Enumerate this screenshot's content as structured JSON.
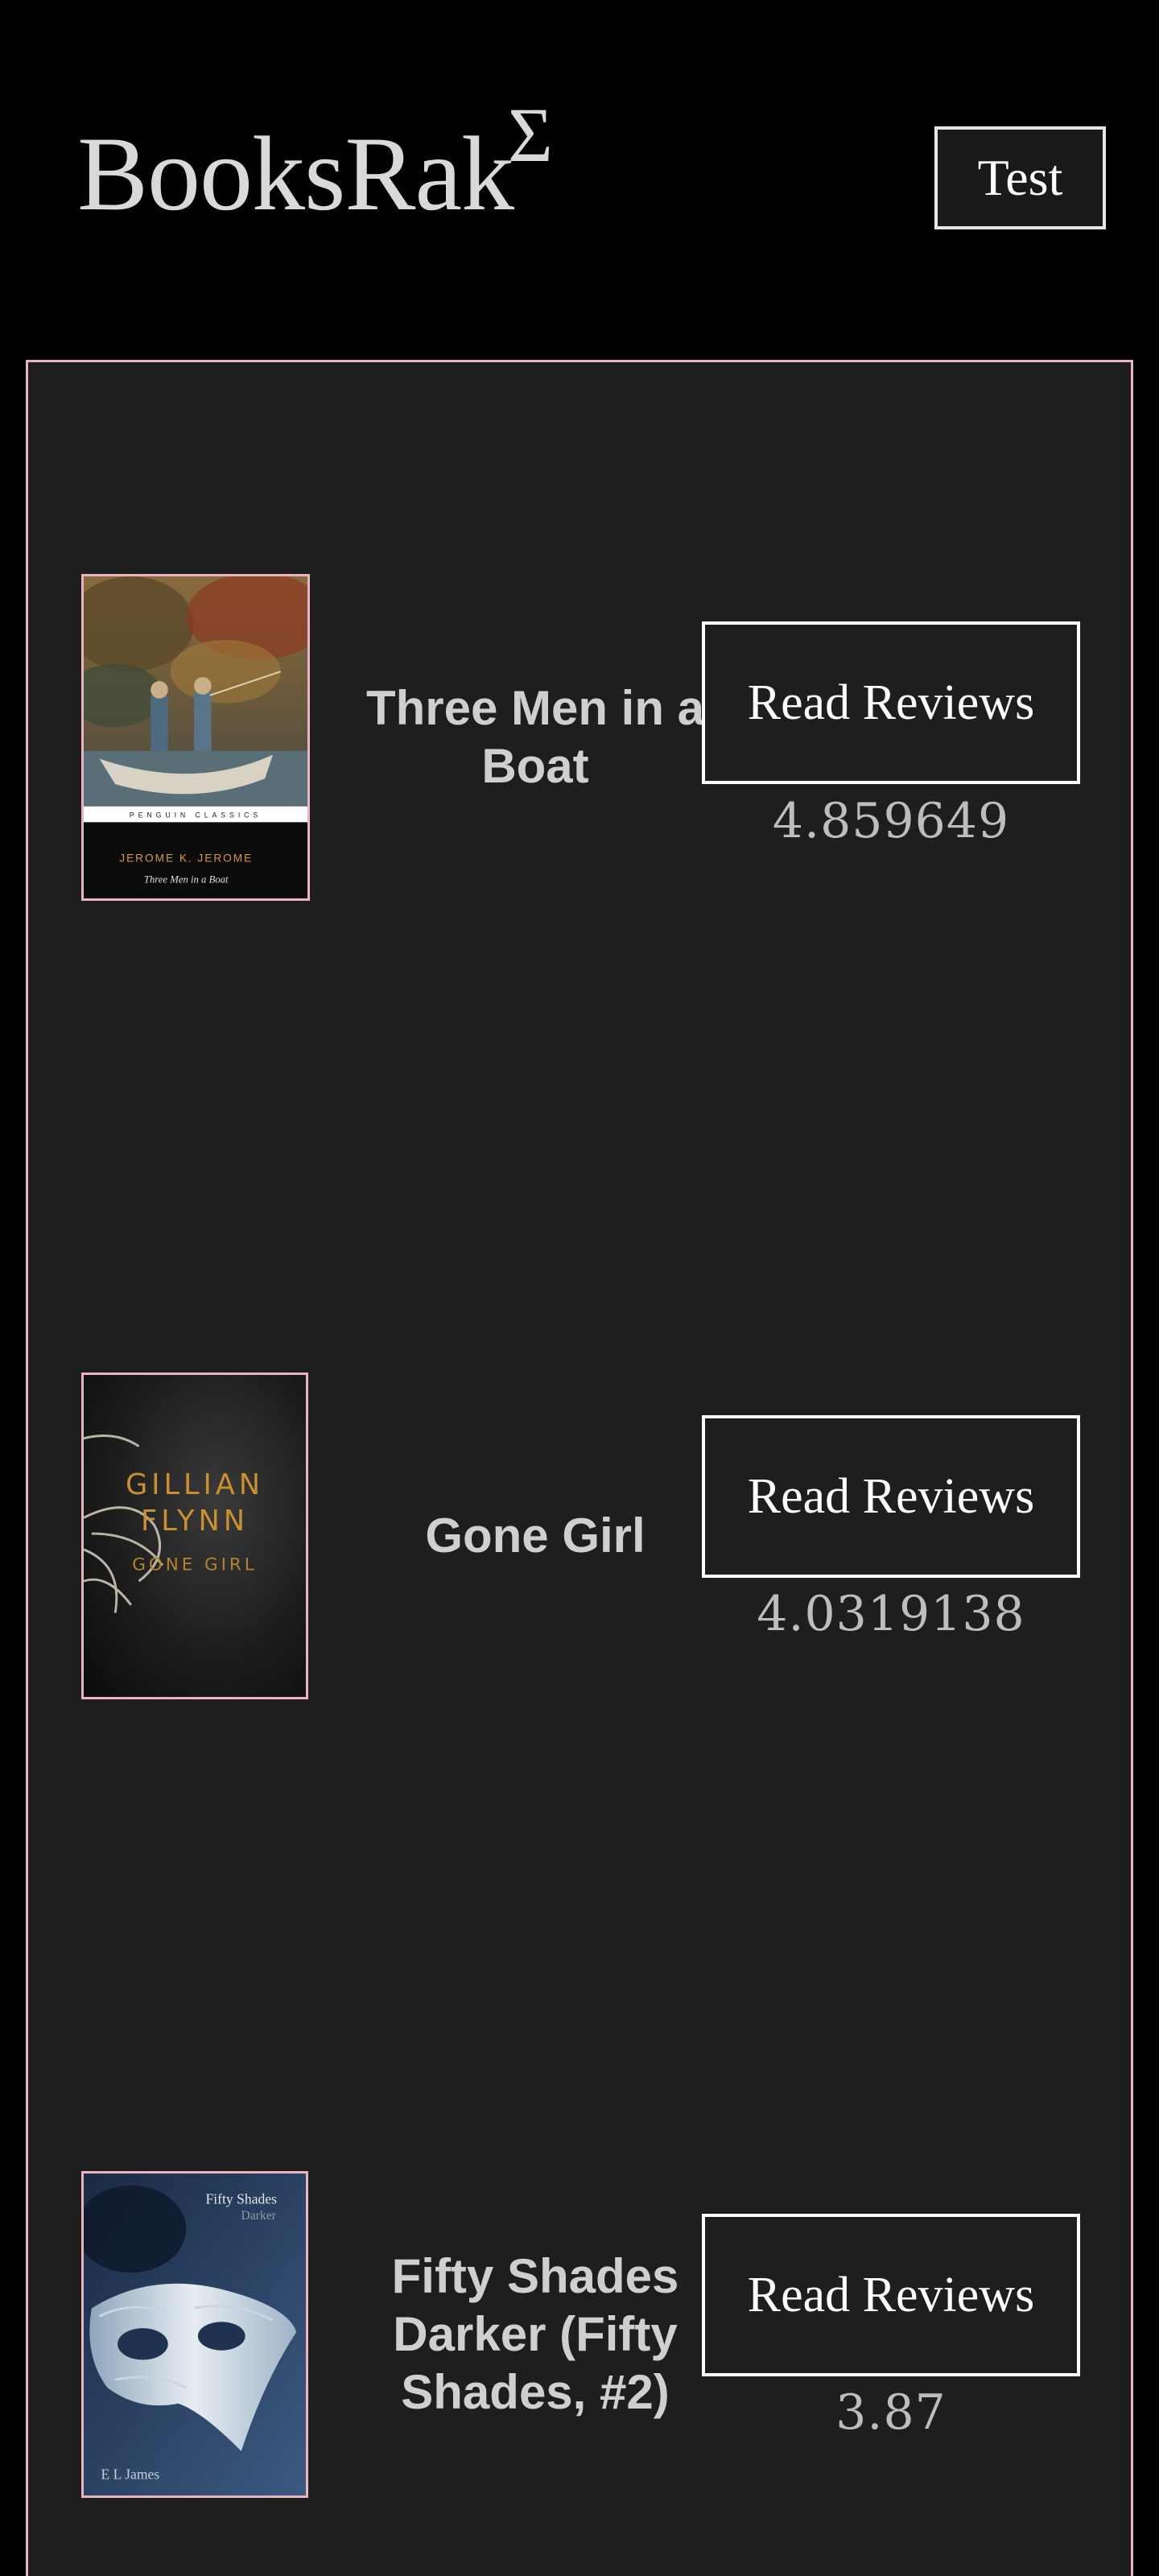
{
  "header": {
    "brand": "BooksRak",
    "brand_superscript": "Σ",
    "test_button_label": "Test"
  },
  "books": [
    {
      "title": "Three Men in a Boat",
      "read_reviews_label": "Read Reviews",
      "rating": "4.859649",
      "cover_text": {
        "publisher_band": "PENGUIN CLASSICS",
        "author": "JEROME K. JEROME",
        "title": "Three Men in a Boat"
      }
    },
    {
      "title": "Gone Girl",
      "read_reviews_label": "Read Reviews",
      "rating": "4.0319138",
      "cover_text": {
        "author_first": "GILLIAN",
        "author_last": "FLYNN",
        "title": "GONE GIRL"
      }
    },
    {
      "title": "Fifty Shades Darker (Fifty Shades, #2)",
      "read_reviews_label": "Read Reviews",
      "rating": "3.87",
      "cover_text": {
        "title_line1": "Fifty Shades",
        "title_line2": "Darker",
        "author": "E L James"
      }
    }
  ],
  "colors": {
    "page_background": "#000000",
    "panel_background": "#1e1e1e",
    "panel_border": "#e8b4c0",
    "button_border": "#ffffff",
    "text": "#d6d6d6"
  }
}
